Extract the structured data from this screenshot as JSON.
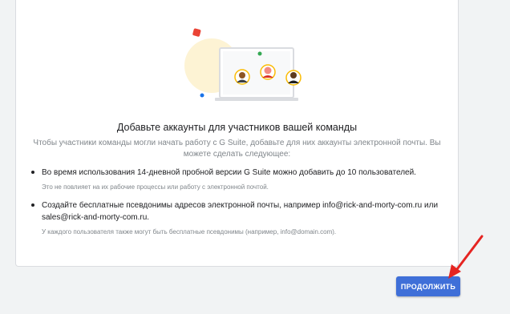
{
  "card": {
    "title": "Добавьте аккаунты для участников вашей команды",
    "subtitle": "Чтобы участники команды могли начать работу с G Suite, добавьте для них аккаунты электронной почты. Вы можете сделать следующее:",
    "items": [
      {
        "main": "Во время использования 14-дневной пробной версии G Suite можно добавить до 10 пользователей.",
        "note": "Это не повлияет на их рабочие процессы или работу с электронной почтой."
      },
      {
        "main": "Создайте бесплатные псевдонимы адресов электронной почты, например info@rick-and-morty-com.ru или sales@rick-and-morty-com.ru.",
        "note": "У каждого пользователя также могут быть бесплатные псевдонимы (например, info@domain.com)."
      }
    ]
  },
  "continue_button": "ПРОДОЛЖИТЬ",
  "colors": {
    "accent": "#3f6fd8",
    "annotation_arrow": "#e52421"
  },
  "illustration": {
    "icons": [
      "laptop-icon",
      "avatar-icon",
      "avatar-icon",
      "avatar-icon"
    ]
  }
}
